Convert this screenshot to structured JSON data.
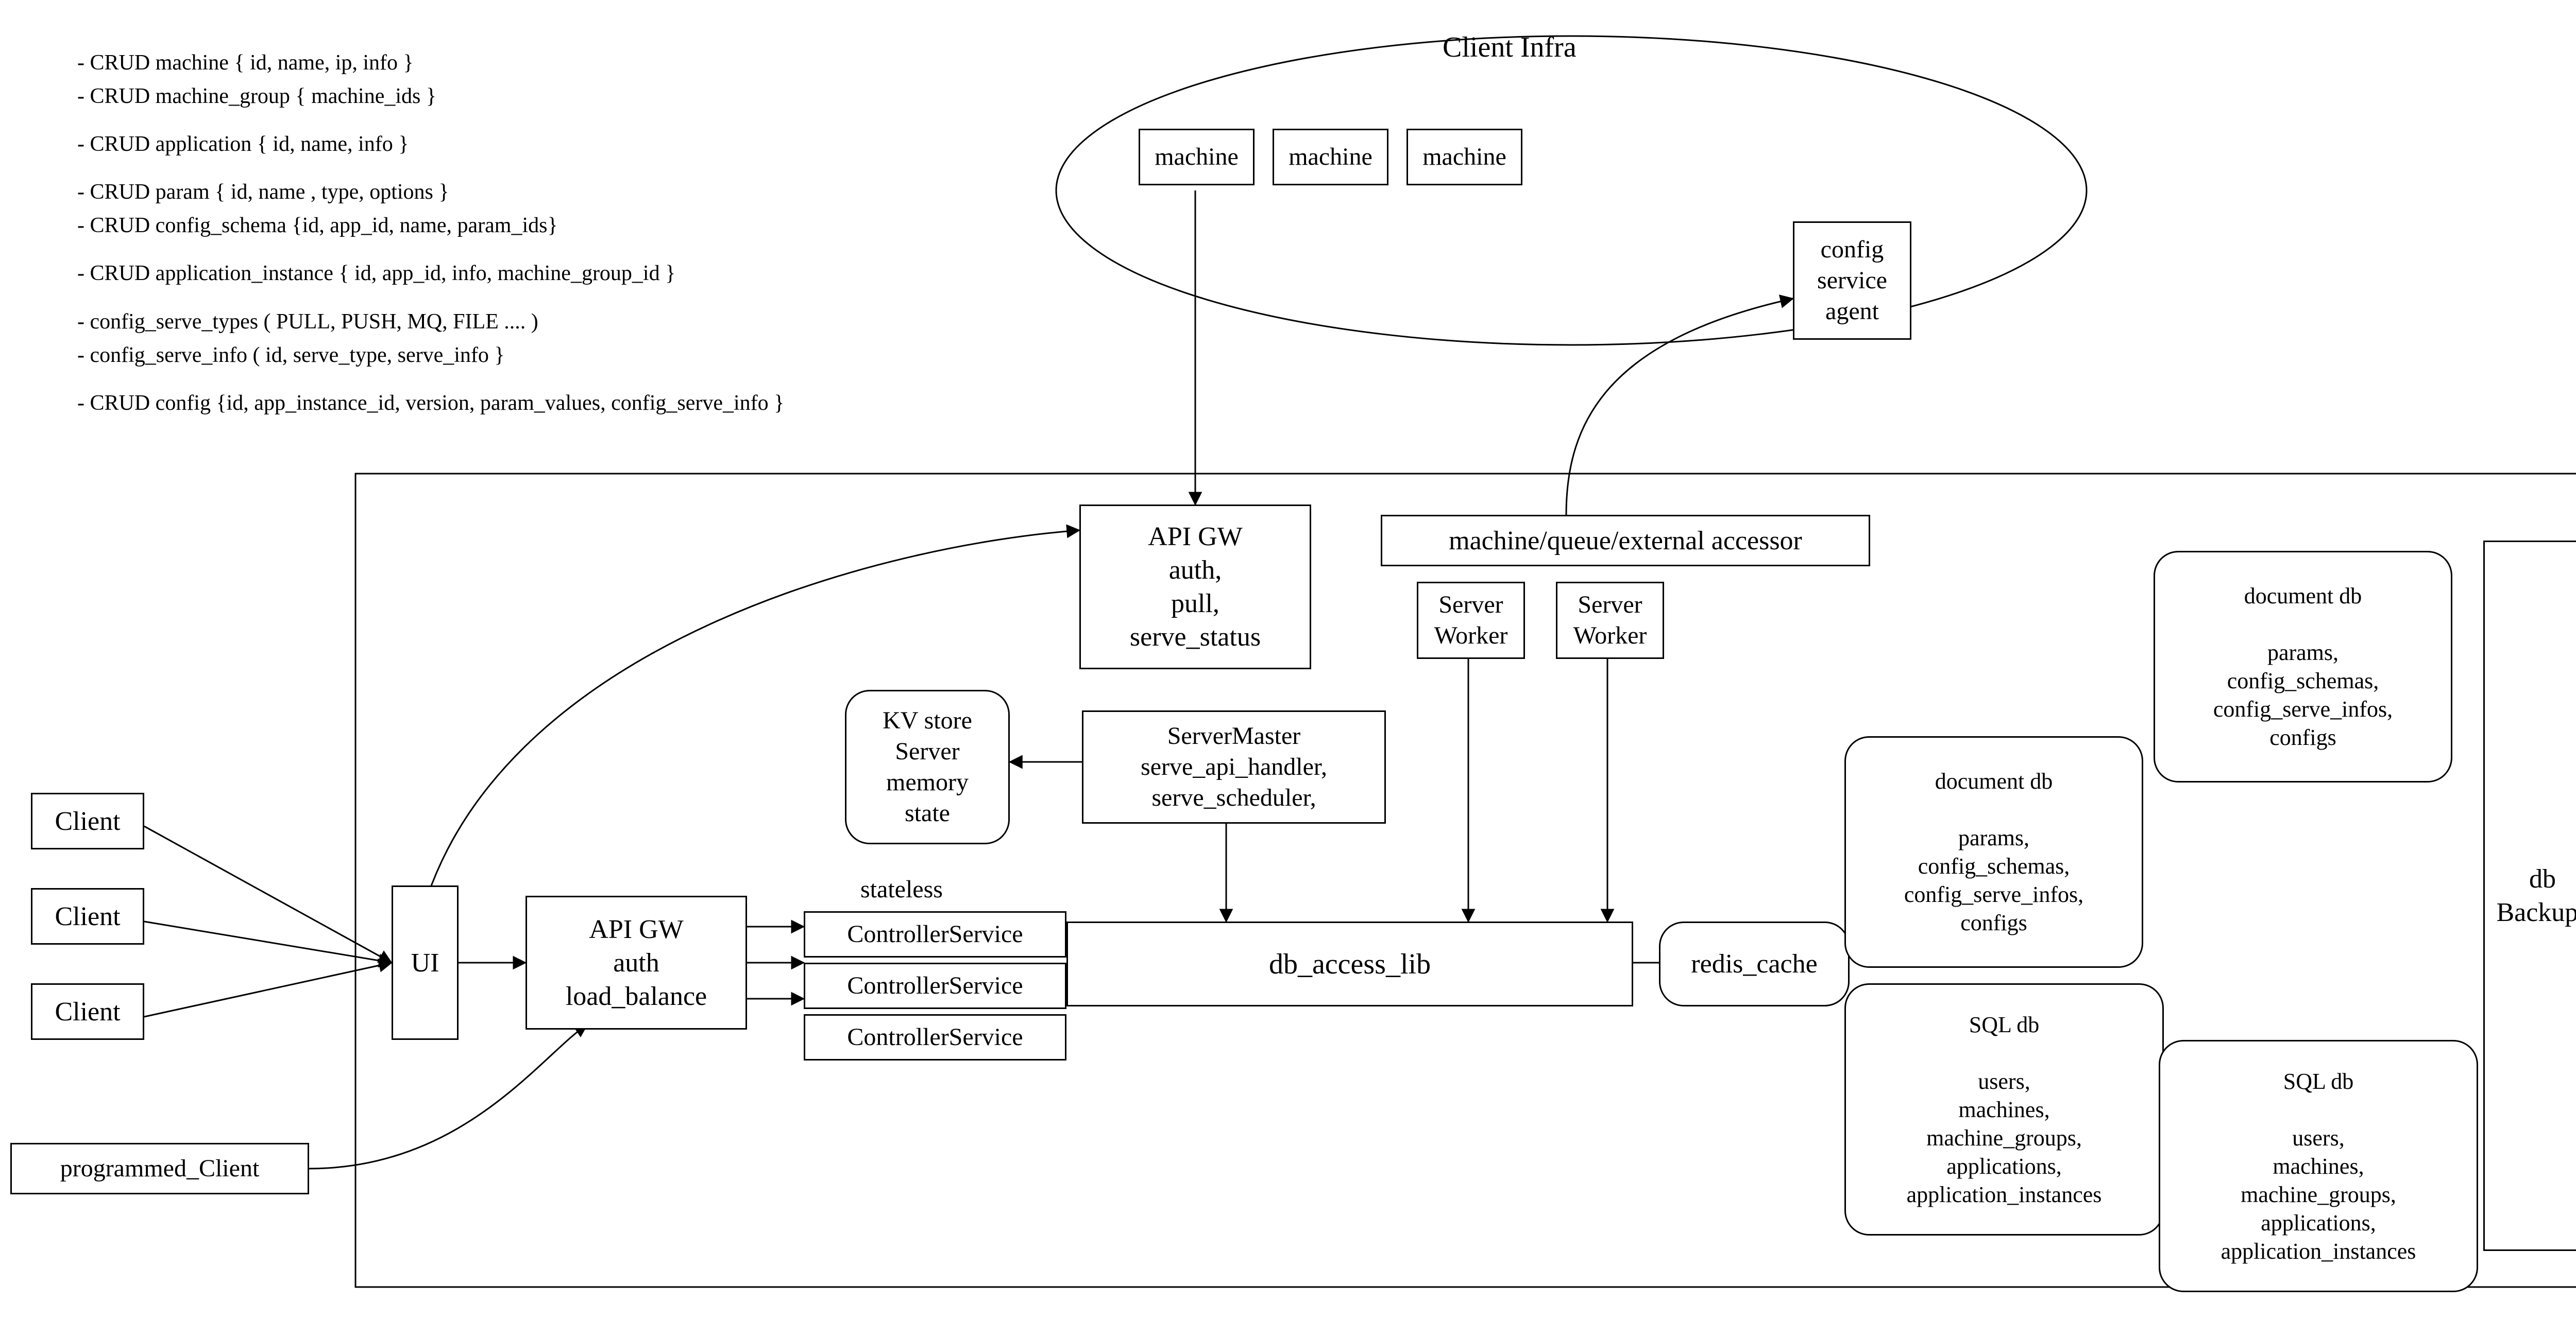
{
  "notes": {
    "l0": "- CRUD machine { id, name, ip, info }",
    "l1": "- CRUD machine_group { machine_ids }",
    "l2": "- CRUD application { id, name, info }",
    "l3": "- CRUD param { id, name , type, options }",
    "l4": "- CRUD config_schema {id, app_id, name, param_ids}",
    "l5": "- CRUD application_instance { id, app_id, info, machine_group_id }",
    "l6": "- config_serve_types ( PULL, PUSH, MQ, FILE .... )",
    "l7": "- config_serve_info ( id, serve_type, serve_info }",
    "l8": "- CRUD config {id, app_instance_id, version, param_values, config_serve_info }"
  },
  "client_infra": {
    "title": "Client Infra",
    "m1": "machine",
    "m2": "machine",
    "m3": "machine",
    "agent": "config\nservice\nagent"
  },
  "clients": {
    "c1": "Client",
    "c2": "Client",
    "c3": "Client",
    "programmed": "programmed_Client"
  },
  "ui": "UI",
  "api_gw_auth_lb": "API GW\nauth\nload_balance",
  "stateless_label": "stateless",
  "controller1": "ControllerService",
  "controller2": "ControllerService",
  "controller3": "ControllerService",
  "api_gw_serve": "API GW\nauth,\npull,\nserve_status",
  "kv_store": "KV store\nServer\nmemory\nstate",
  "server_master": "ServerMaster\nserve_api_handler,\nserve_scheduler,",
  "accessor": "machine/queue/external accessor",
  "worker1": "Server\nWorker",
  "worker2": "Server\nWorker",
  "db_access": "db_access_lib",
  "redis": "redis_cache",
  "docdb1": "document db\n\nparams,\nconfig_schemas,\nconfig_serve_infos,\nconfigs",
  "docdb2": "document db\n\nparams,\nconfig_schemas,\nconfig_serve_infos,\nconfigs",
  "sqldb1": "SQL db\n\nusers,\nmachines,\nmachine_groups,\napplications,\napplication_instances",
  "sqldb2": "SQL db\n\nusers,\nmachines,\nmachine_groups,\napplications,\napplication_instances",
  "backups": "db\nBackups"
}
